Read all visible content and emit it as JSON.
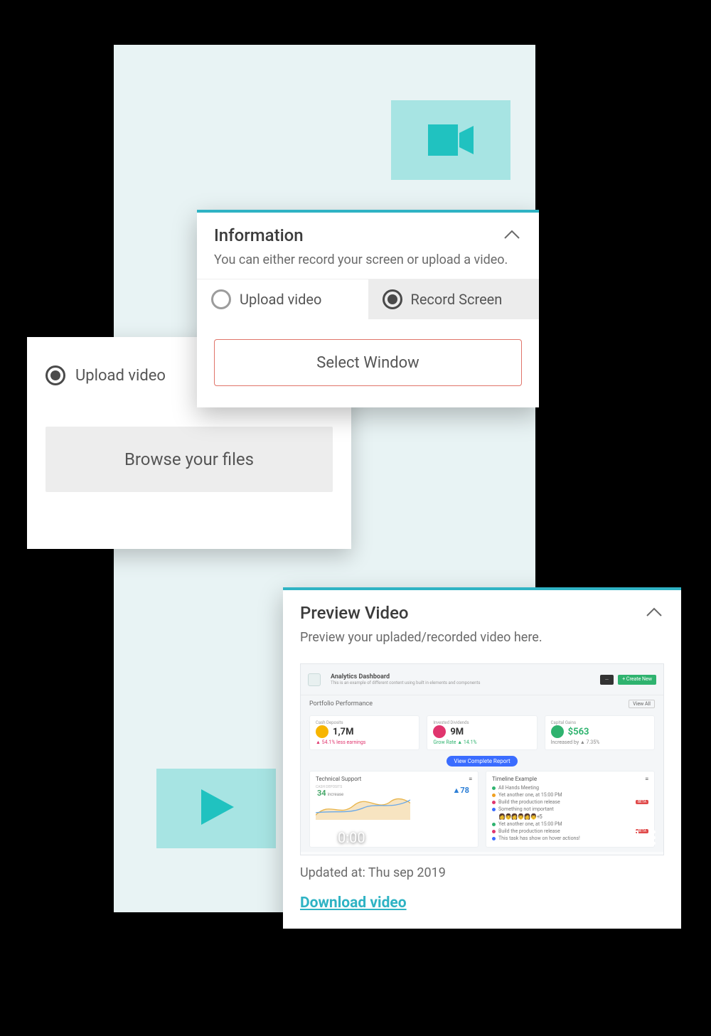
{
  "icons": {
    "camera": "camera-icon",
    "play": "play-icon",
    "chevron_up": "chevron-up-icon",
    "fullscreen": "fullscreen-icon",
    "more": "more-vertical-icon"
  },
  "colors": {
    "accent": "#2fb3c4",
    "danger_border": "#e0746a",
    "badge_bg": "#a7e4e3",
    "green": "#2fb36f",
    "blue": "#3a6cff",
    "orange": "#f0a020",
    "pink": "#e0356e"
  },
  "upload_card": {
    "radio_label": "Upload video",
    "radio_selected": true,
    "browse_label": "Browse your files"
  },
  "info_card": {
    "title": "Information",
    "subtitle": "You can either record your screen or upload a video.",
    "tabs": {
      "upload": {
        "label": "Upload video",
        "selected": false
      },
      "record": {
        "label": "Record Screen",
        "selected": true
      }
    },
    "select_button": "Select Window"
  },
  "preview_card": {
    "title": "Preview Video",
    "subtitle": "Preview your upladed/recorded video here.",
    "dashboard": {
      "header_title": "Analytics Dashboard",
      "header_sub": "This is an example of different content using built in elements and components",
      "btn_dark": "—",
      "btn_green": "+ Create New",
      "section": "Portfolio Performance",
      "view_all": "View All",
      "metrics": [
        {
          "label": "Cash Deposits",
          "value": "1,7M",
          "sub": "▲ 54.1% less earnings",
          "sub_color": "#e0356e",
          "icon_color": "#f7b500"
        },
        {
          "label": "Invested Dividends",
          "value": "9M",
          "sub": "Grow Rate ▲ 14.1%",
          "sub_color": "#2fb36f",
          "icon_color": "#e0356e"
        },
        {
          "label": "Capital Gains",
          "value": "$563",
          "value_color": "#2fb36f",
          "sub": "Increased by ▲ 7.35%",
          "sub_color": "#888",
          "icon_color": "#2fb36f"
        }
      ],
      "view_report_btn": "View Complete Report",
      "panel_left": {
        "title": "Technical Support",
        "subtitle_small": "CASH DEPOSITS",
        "stat": "34",
        "stat_note": "increase",
        "right_stat": "78"
      },
      "panel_right": {
        "title": "Timeline Example",
        "rows": [
          {
            "color": "#2fb36f",
            "text": "All Hands Meeting"
          },
          {
            "color": "#f0a020",
            "text": "Yet another one, at 15:00 PM"
          },
          {
            "color": "#e0356e",
            "text": "Build the production release",
            "beta": "BETA"
          },
          {
            "color": "#3a6cff",
            "text": "Something not important"
          },
          {
            "color": "#2fb36f",
            "text": "Yet another one, at 15:00 PM"
          },
          {
            "color": "#e0356e",
            "text": "Build the production release",
            "beta": "BETA"
          },
          {
            "color": "#3a6cff",
            "text": "This task has show on hover actions!"
          }
        ],
        "emoji_row": "👩👨👩👨👩👨+5"
      }
    },
    "player": {
      "time": "0:00"
    },
    "updated_label": "Updated at: Thu sep 2019",
    "download_label": "Download video"
  }
}
